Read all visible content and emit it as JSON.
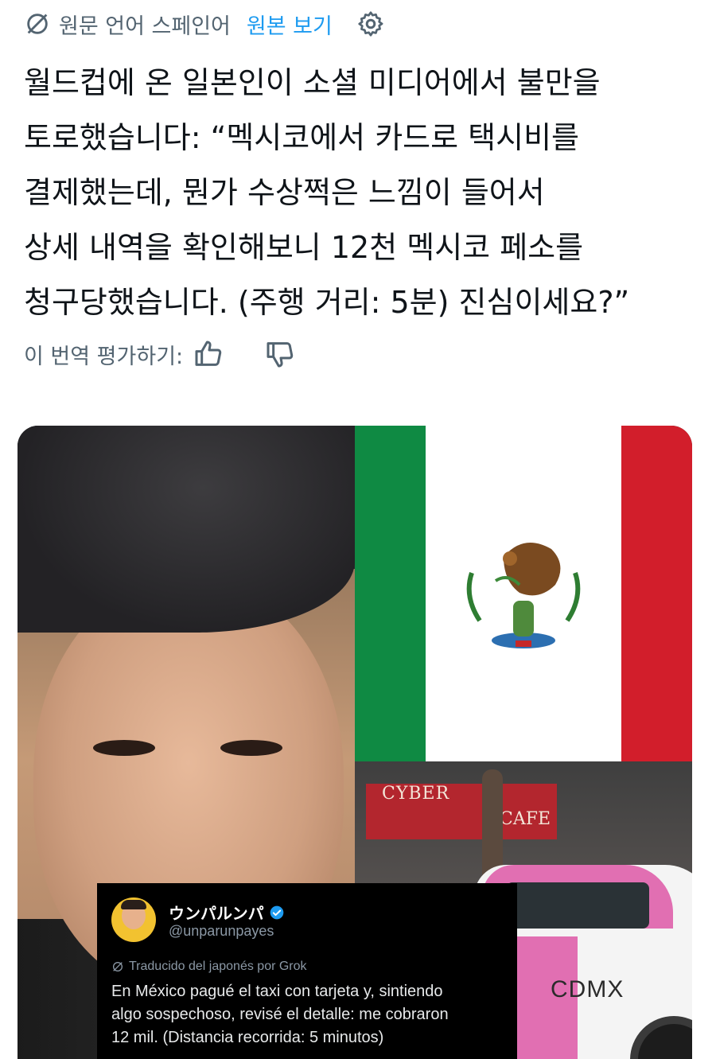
{
  "translation_bar": {
    "original_language": "원문 언어 스페인어",
    "show_original": "원본 보기"
  },
  "tweet": {
    "lines": [
      "월드컵에 온 일본인이 소셜 미디어에서 불만을",
      "토로했습니다: “멕시코에서 카드로 택시비를",
      "결제했는데, 뭔가 수상쩍은 느낌이 들어서",
      "상세 내역을 확인해보니 12천 멕시코 페소를",
      "청구당했습니다. (주행 거리: 5분) 진심이세요?”"
    ]
  },
  "rate_translation": {
    "label": "이 번역 평가하기:"
  },
  "media": {
    "street_signs": {
      "cyber": "CYBER",
      "cafe": "CAFE",
      "taxi": "CDMX"
    },
    "embedded_post": {
      "display_name": "ウンパルンパ",
      "handle": "@unparunpayes",
      "translated_note": "Traducido del japonés por Grok",
      "lines": [
        "En México pagué el taxi con tarjeta y, sintiendo",
        "algo sospechoso, revisé el detalle: me cobraron",
        "12 mil. (Distancia recorrida: 5 minutos)"
      ]
    }
  },
  "colors": {
    "link": "#1d9bf0",
    "muted": "#536471",
    "flag_green": "#0f8a43",
    "flag_red": "#d21e2b",
    "taxi_pink": "#e16fb2"
  },
  "icons": [
    "translate-globe-icon",
    "gear-icon",
    "thumbs-up-icon",
    "thumbs-down-icon",
    "verified-badge-icon"
  ]
}
